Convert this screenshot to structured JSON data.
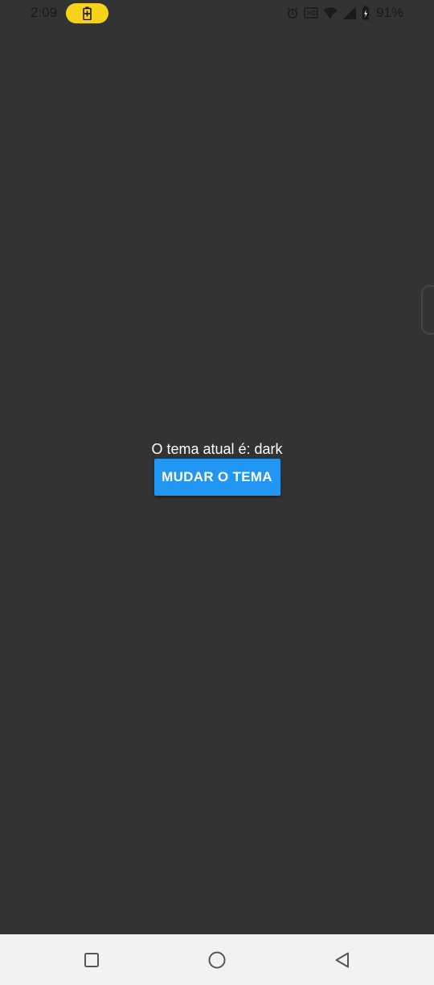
{
  "status_bar": {
    "time": "2:09",
    "battery_percent": "91%",
    "icons": [
      "battery-saver-icon",
      "alarm-icon",
      "hd-icon",
      "wifi-icon",
      "signal-icon",
      "battery-icon"
    ],
    "battery_pill_color": "#f7d21a"
  },
  "main": {
    "theme_label": "O tema atual é: dark",
    "button_label": "MUDAR O TEMA"
  },
  "colors": {
    "background": "#333333",
    "button": "#2196f3",
    "nav_bar": "#f2f2f2"
  },
  "nav_bar": {
    "buttons": [
      "recents-icon",
      "home-icon",
      "back-icon"
    ]
  }
}
